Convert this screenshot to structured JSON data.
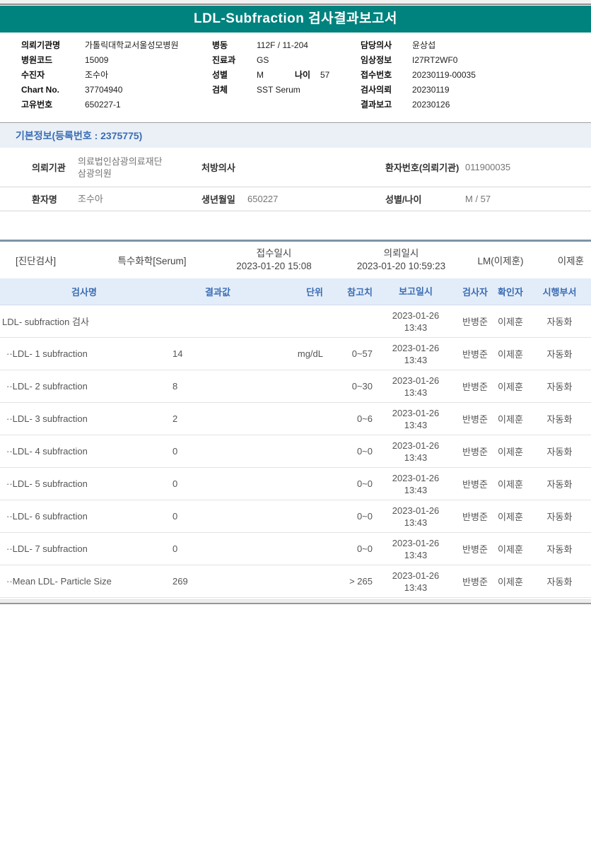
{
  "colors": {
    "banner_teal": "#00827E",
    "section_blue_text": "#3A6CB4",
    "section_bg": "#EAF0F6",
    "table_header_bg": "#E3EDF9",
    "exam_divider": "#7B95A9"
  },
  "header": {
    "title": "LDL-Subfraction 검사결과보고서"
  },
  "patient_info": {
    "left": [
      {
        "label": "의뢰기관명",
        "value": "가톨릭대학교서울성모병원"
      },
      {
        "label": "병원코드",
        "value": "15009"
      },
      {
        "label": "수진자",
        "value": "조수아"
      },
      {
        "label": "Chart No.",
        "value": "37704940"
      },
      {
        "label": "고유번호",
        "value": "650227-1"
      }
    ],
    "middle": [
      {
        "label": "병동",
        "value": "112F / 11-204"
      },
      {
        "label": "진료과",
        "value": "GS"
      },
      {
        "label": "성별",
        "value": "M",
        "label2": "나이",
        "value2": "57"
      },
      {
        "label": "검체",
        "value": "SST Serum"
      }
    ],
    "right": [
      {
        "label": "담당의사",
        "value": "윤상섭"
      },
      {
        "label": "임상정보",
        "value": "I27RT2WF0"
      },
      {
        "label": "접수번호",
        "value": "20230119-00035"
      },
      {
        "label": "검사의뢰",
        "value": "20230119"
      },
      {
        "label": "결과보고",
        "value": "20230126"
      }
    ]
  },
  "basic_info": {
    "section_title": "기본정보(등록번호 : 2375775)",
    "rows": [
      {
        "height": "tall",
        "cells": [
          {
            "label": "의뢰기관",
            "value": "의료법인삼광의료재단\n삼광의원"
          },
          {
            "label": "처방의사",
            "value": ""
          },
          {
            "label": "환자번호(의뢰기관)",
            "value": "011900035"
          }
        ]
      },
      {
        "height": "short",
        "cells": [
          {
            "label": "환자명",
            "value": "조수아"
          },
          {
            "label": "생년월일",
            "value": "650227"
          },
          {
            "label": "성별/나이",
            "value": "M / 57"
          }
        ]
      }
    ]
  },
  "exam_section": {
    "department": "[진단검사]",
    "category": "특수화학[Serum]",
    "receipt_label": "접수일시",
    "receipt_datetime": "2023-01-20 15:08",
    "request_label": "의뢰일시",
    "request_datetime": "2023-01-20 10:59:23",
    "lm": "LM(이제훈)",
    "reader": "이제훈"
  },
  "results_table": {
    "headers": {
      "name": "검사명",
      "result": "결과값",
      "unit": "단위",
      "ref": "참고치",
      "date": "보고일시",
      "tester": "검사자",
      "confirmer": "확인자",
      "dept": "시행부서"
    },
    "rows": [
      {
        "name": "LDL- subfraction 검사",
        "indent": false,
        "result": "",
        "unit": "",
        "ref": "",
        "date": "2023-01-26",
        "time": "13:43",
        "tester": "반병준",
        "confirmer": "이제훈",
        "dept": "자동화"
      },
      {
        "name": "··LDL- 1 subfraction",
        "indent": true,
        "result": "14",
        "unit": "mg/dL",
        "ref": "0~57",
        "date": "2023-01-26",
        "time": "13:43",
        "tester": "반병준",
        "confirmer": "이제훈",
        "dept": "자동화"
      },
      {
        "name": "··LDL- 2 subfraction",
        "indent": true,
        "result": "8",
        "unit": "",
        "ref": "0~30",
        "date": "2023-01-26",
        "time": "13:43",
        "tester": "반병준",
        "confirmer": "이제훈",
        "dept": "자동화"
      },
      {
        "name": "··LDL- 3 subfraction",
        "indent": true,
        "result": "2",
        "unit": "",
        "ref": "0~6",
        "date": "2023-01-26",
        "time": "13:43",
        "tester": "반병준",
        "confirmer": "이제훈",
        "dept": "자동화"
      },
      {
        "name": "··LDL- 4 subfraction",
        "indent": true,
        "result": "0",
        "unit": "",
        "ref": "0~0",
        "date": "2023-01-26",
        "time": "13:43",
        "tester": "반병준",
        "confirmer": "이제훈",
        "dept": "자동화"
      },
      {
        "name": "··LDL- 5 subfraction",
        "indent": true,
        "result": "0",
        "unit": "",
        "ref": "0~0",
        "date": "2023-01-26",
        "time": "13:43",
        "tester": "반병준",
        "confirmer": "이제훈",
        "dept": "자동화"
      },
      {
        "name": "··LDL- 6 subfraction",
        "indent": true,
        "result": "0",
        "unit": "",
        "ref": "0~0",
        "date": "2023-01-26",
        "time": "13:43",
        "tester": "반병준",
        "confirmer": "이제훈",
        "dept": "자동화"
      },
      {
        "name": "··LDL- 7 subfraction",
        "indent": true,
        "result": "0",
        "unit": "",
        "ref": "0~0",
        "date": "2023-01-26",
        "time": "13:43",
        "tester": "반병준",
        "confirmer": "이제훈",
        "dept": "자동화"
      },
      {
        "name": "··Mean LDL- Particle Size",
        "indent": true,
        "result": "269",
        "unit": "",
        "ref": "> 265",
        "date": "2023-01-26",
        "time": "13:43",
        "tester": "반병준",
        "confirmer": "이제훈",
        "dept": "자동화"
      }
    ]
  }
}
